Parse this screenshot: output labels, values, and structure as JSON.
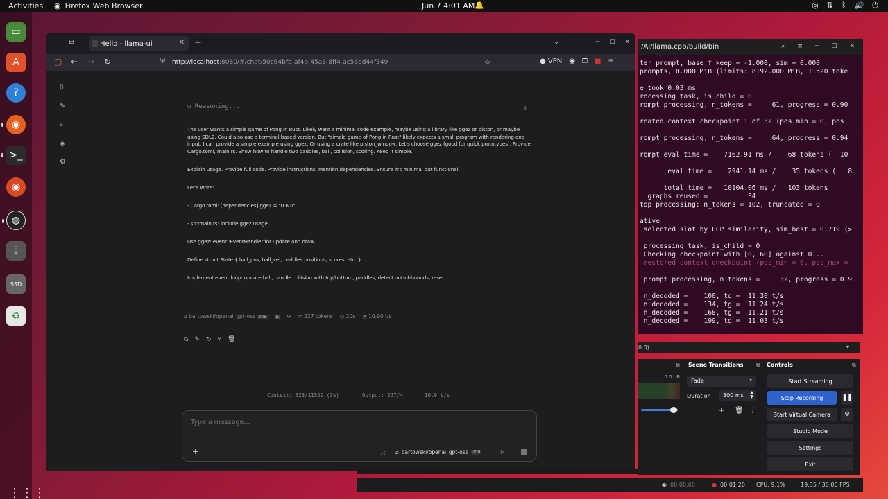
{
  "topbar": {
    "activities": "Activities",
    "app_name": "Firefox Web Browser",
    "clock": "Jun 7  4:01 AM"
  },
  "dock": {
    "items": [
      "files-icon",
      "app-center-icon",
      "help-icon",
      "firefox-icon",
      "terminal-icon",
      "firefox-nightly-icon",
      "obs-icon",
      "usb-drive-icon",
      "ssd-drive-icon",
      "trash-icon"
    ]
  },
  "browser": {
    "tab_title": "Hello - llama-ui",
    "url_host": "http://localhost",
    "url_rest": ":8080/#/chat/50c64bfb-af4b-45a3-8ff4-ac56dd44f349",
    "vpn_label": "VPN"
  },
  "chat": {
    "reasoning_label": "Reasoning...",
    "reasoning_paragraphs": [
      "The user wants a simple game of Pong in Rust. Likely want a minimal code example, maybe using a library like ggez or piston, or maybe using SDL2. Could also use a terminal based version. But \"simple game of Pong in Rust\" likely expects a small program with rendering and input. I can provide a simple example using ggez. Or using a crate like piston_window. Let's choose ggez (good for quick prototypes). Provide Cargo.toml, main.rs. Show how to handle two paddles, ball, collision, scoring. Keep it simple.",
      "Explain usage. Provide full code. Provide instructions. Mention dependencies. Ensure it's minimal but functional.",
      "Let's write:",
      "- Cargo.toml: [dependencies] ggez = \"0.6.0\"",
      "- src/main.rs: include ggez usage.",
      "Use ggez::event::EventHandler for update and draw.",
      "Define struct State { ball_pos, ball_vel, paddles positions, scores, etc. }",
      "Implement event loop: update ball, handle collision with top/bottom, paddles, detect out-of-bounds, reset."
    ],
    "meta": {
      "model": "bartowski/openai_gpt-oss",
      "model_badge": "20B",
      "tokens": "227 tokens",
      "time": "20s",
      "speed": "10.90 t/s"
    },
    "context_bar": {
      "context": "Context: 323/11520 (3%)",
      "output": "Output: 227/∞",
      "speed": "10.9 t/s"
    },
    "composer": {
      "placeholder": "Type a message...",
      "model": "bartowski/openai_gpt-oss",
      "model_badge": "20B"
    }
  },
  "terminal": {
    "title": "/AI/llama.cpp/build/bin",
    "lines": [
      "ter prompt, base f_keep = -1.000, sim = 0.000",
      "prompts, 0.000 MiB (limits: 8192.000 MiB, 11520 toke",
      "",
      "e took 0.03 ms",
      "rocessing task, is_child = 0",
      "rompt processing, n_tokens =     61, progress = 0.90",
      "",
      "reated context checkpoint 1 of 32 (pos_min = 0, pos_",
      "",
      "rompt processing, n_tokens =     64, progress = 0.94",
      "",
      "rompt eval time =    7162.91 ms /    68 tokens (  10",
      "",
      "       eval time =    2941.14 ms /    35 tokens (   8",
      "",
      "      total time =   10104.06 ms /   103 tokens",
      "  graphs reused =          34",
      "top processing: n_tokens = 102, truncated = 0",
      "",
      "ative",
      " selected slot by LCP similarity, sim_best = 0.719 (>",
      "",
      " processing task, is_child = 0",
      " Checking checkpoint with [0, 60] against 0...",
      " restored context checkpoint (pos_min = 0, pos_max =",
      "",
      " prompt processing, n_tokens =     32, progress = 0.9",
      "",
      " n_decoded =    100, tg =  11.30 t/s",
      " n_decoded =    134, tg =  11.24 t/s",
      " n_decoded =    168, tg =  11.21 t/s",
      " n_decoded =    199, tg =  11.03 t/s"
    ]
  },
  "obs": {
    "source_bar": "0.0)",
    "mixer_db": "0.0 dB",
    "scene_transitions": {
      "title": "Scene Transitions",
      "transition": "Fade",
      "duration_label": "Duration",
      "duration_value": "300 ms"
    },
    "controls": {
      "title": "Controls",
      "start_streaming": "Start Streaming",
      "stop_recording": "Stop Recording",
      "start_virtual_camera": "Start Virtual Camera",
      "studio_mode": "Studio Mode",
      "settings": "Settings",
      "exit": "Exit"
    },
    "status": {
      "stream_time": "00:00:00",
      "rec_time": "00:01:20",
      "cpu": "CPU: 9.1%",
      "fps": "19.35 / 30.00 FPS"
    }
  }
}
